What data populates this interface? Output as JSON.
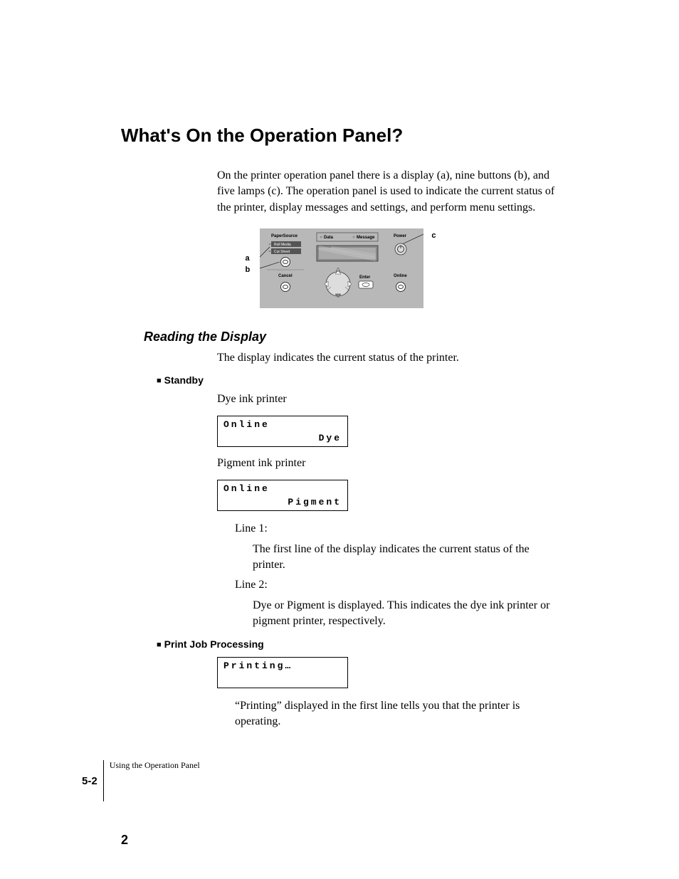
{
  "title": "What's On the Operation Panel?",
  "intro": "On the printer operation panel there is a display (a), nine buttons (b), and five lamps (c). The operation panel is used to indicate the current status of the printer, display messages and settings, and perform menu settings.",
  "panel_labels": {
    "a": "a",
    "b": "b",
    "c": "c"
  },
  "panel_ui": {
    "paper_source": "PaperSource",
    "roll_media": "Roll Media",
    "cut_sheet": "Cut Sheet",
    "cancel": "Cancel",
    "data": "Data",
    "message": "Message",
    "enter": "Enter",
    "power": "Power",
    "online": "Online"
  },
  "subheading": "Reading the Display",
  "sub_p": "The display indicates the current status of the printer.",
  "standby_h": "Standby",
  "dye_p": "Dye ink printer",
  "lcd_dye": {
    "l1": "Online",
    "l2": "Dye"
  },
  "pigment_p": "Pigment ink printer",
  "lcd_pigment": {
    "l1": "Online",
    "l2": "Pigment"
  },
  "line1_label": "Line 1:",
  "line1_body": "The first line of the display indicates the current status of the printer.",
  "line2_label": "Line 2:",
  "line2_body": "Dye or Pigment is displayed. This indicates the dye ink printer or pigment printer, respectively.",
  "print_h": "Print Job Processing",
  "lcd_print": {
    "l1": "Printing…",
    "l2": ""
  },
  "print_body": "“Printing” displayed in the first line tells you that the printer is operating.",
  "footer_page": "5-2",
  "footer_chapter": "Using the Operation Panel",
  "page_no": "2"
}
